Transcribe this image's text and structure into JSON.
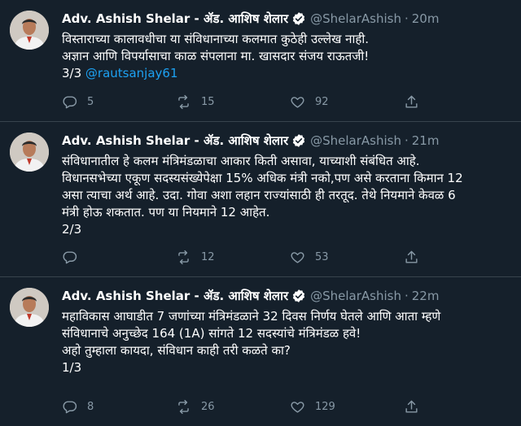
{
  "tweets": [
    {
      "name": "Adv. Ashish Shelar - ॲड. आशिष शेलार",
      "handle": "@ShelarAshish",
      "separator": "·",
      "time": "20m",
      "lines": [
        "विस्ताराच्या कालावधीचा या संविधानाच्या कलमात कुठेही उल्लेख नाही.",
        "अज्ञान आणि विपर्यासाचा काळ संपलाना मा. खासदार संजय राऊतजी!"
      ],
      "counter_prefix": "3/3 ",
      "mention": "@rautsanjay61",
      "replies": "5",
      "retweets": "15",
      "likes": "92"
    },
    {
      "name": "Adv. Ashish Shelar - ॲड. आशिष शेलार",
      "handle": "@ShelarAshish",
      "separator": "·",
      "time": "21m",
      "lines": [
        "संविधानातील हे कलम मंत्रिमंडळाचा आकार किती असावा, याच्याशी संबंधित आहे.",
        "विधानसभेच्या एकूण सदस्यसंख्येपेक्षा 15% अधिक मंत्री नको,पण असे करताना किमान 12",
        "असा त्याचा अर्थ आहे. उदा. गोवा अशा लहान राज्यांसाठी ही तरतूद. तेथे नियमाने केवळ 6",
        "मंत्री होऊ शकतात. पण या नियमाने 12 आहेत.",
        "2/3"
      ],
      "replies": "",
      "retweets": "12",
      "likes": "53"
    },
    {
      "name": "Adv. Ashish Shelar - ॲड. आशिष शेलार",
      "handle": "@ShelarAshish",
      "separator": "·",
      "time": "22m",
      "lines": [
        "महाविकास आघाडीत 7 जणांच्या मंत्रिमंडळाने 32 दिवस निर्णय घेतले आणि आता म्हणे",
        "संविधानाचे अनुच्छेद 164 (1A) सांगते 12 सदस्यांचे मंत्रिमंडळ हवे!",
        "अहो तुम्हाला कायदा, संविधान काही तरी कळते का?",
        "1/3"
      ],
      "replies": "8",
      "retweets": "26",
      "likes": "129"
    }
  ],
  "icons": {
    "verified": "verified-badge-icon",
    "reply": "reply-icon",
    "retweet": "retweet-icon",
    "like": "heart-icon",
    "share": "share-icon"
  },
  "colors": {
    "background": "#15202b",
    "border": "#38444d",
    "muted": "#8899a6",
    "accent": "#1da1f2",
    "text": "#ffffff"
  }
}
